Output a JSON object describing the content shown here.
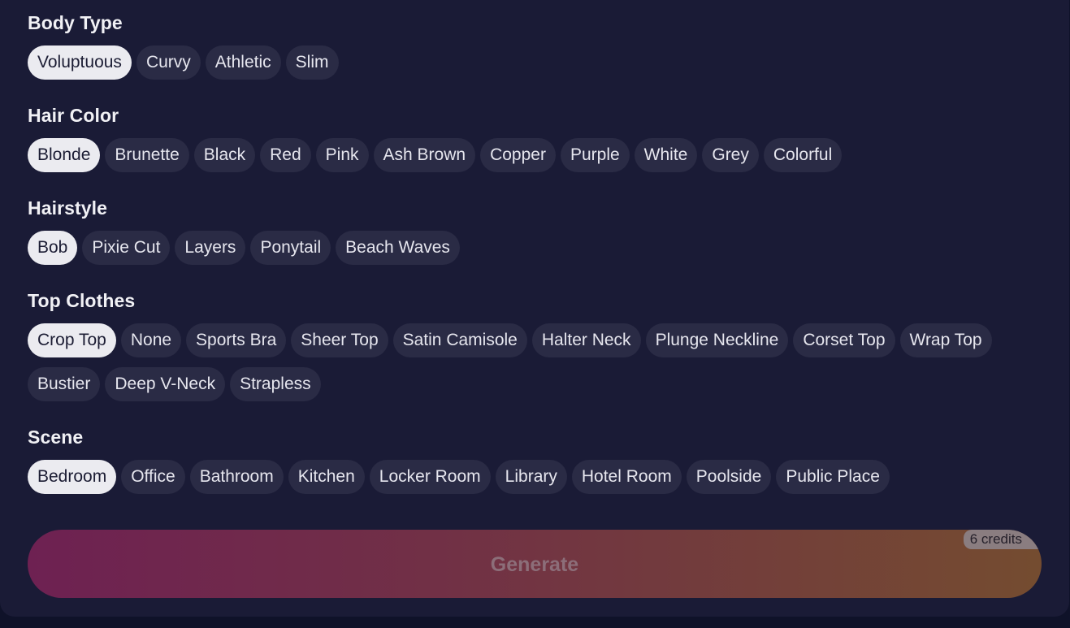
{
  "sections": [
    {
      "title": "Body Type",
      "options": [
        "Voluptuous",
        "Curvy",
        "Athletic",
        "Slim"
      ],
      "selected": "Voluptuous"
    },
    {
      "title": "Hair Color",
      "options": [
        "Blonde",
        "Brunette",
        "Black",
        "Red",
        "Pink",
        "Ash Brown",
        "Copper",
        "Purple",
        "White",
        "Grey",
        "Colorful"
      ],
      "selected": "Blonde"
    },
    {
      "title": "Hairstyle",
      "options": [
        "Bob",
        "Pixie Cut",
        "Layers",
        "Ponytail",
        "Beach Waves"
      ],
      "selected": "Bob"
    },
    {
      "title": "Top Clothes",
      "options": [
        "Crop Top",
        "None",
        "Sports Bra",
        "Sheer Top",
        "Satin Camisole",
        "Halter Neck",
        "Plunge Neckline",
        "Corset Top",
        "Wrap Top",
        "Bustier",
        "Deep V-Neck",
        "Strapless"
      ],
      "selected": "Crop Top"
    },
    {
      "title": "Scene",
      "options": [
        "Bedroom",
        "Office",
        "Bathroom",
        "Kitchen",
        "Locker Room",
        "Library",
        "Hotel Room",
        "Poolside",
        "Public Place"
      ],
      "selected": "Bedroom"
    }
  ],
  "generate": {
    "label": "Generate",
    "credits": "6 credits"
  },
  "colors": {
    "panel_bg": "#1a1b36",
    "chip_bg": "#2a2b45",
    "chip_selected_bg": "#ebebf0",
    "gradient_start": "#6e2152",
    "gradient_end": "#744c30"
  }
}
